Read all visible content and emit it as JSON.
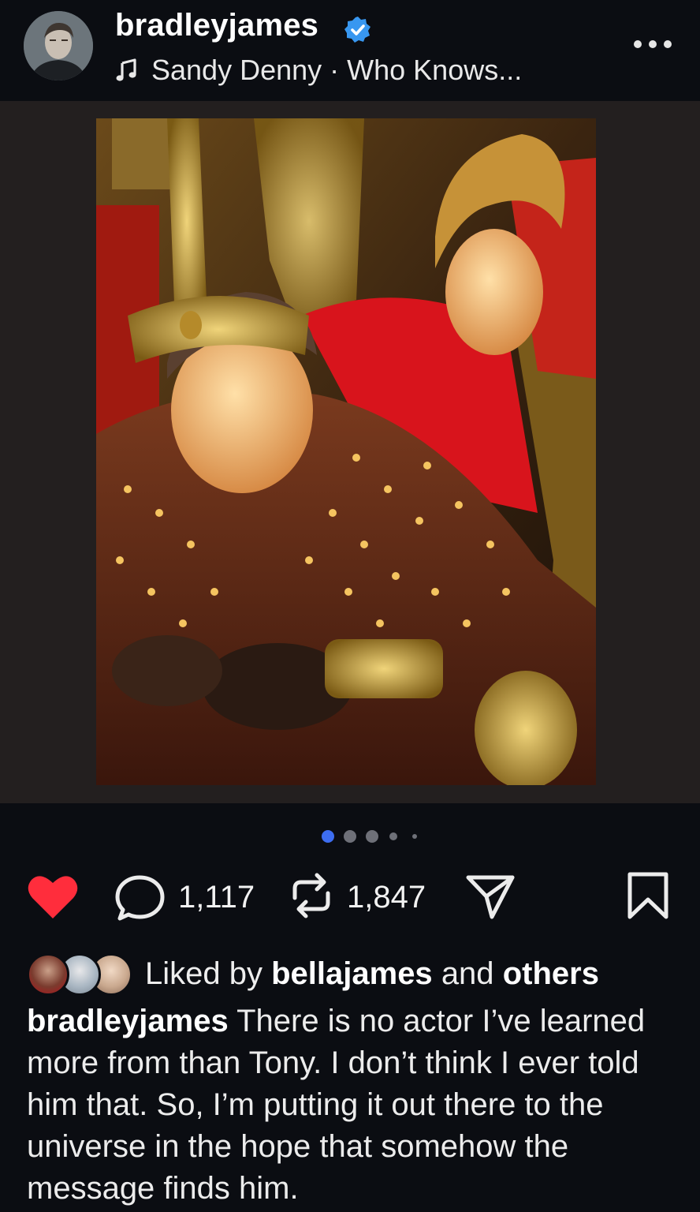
{
  "post": {
    "username": "bradleyjames",
    "music_artist": "Sandy Denny",
    "music_separator": "·",
    "music_title": "Who Knows...",
    "verified_icon": "verified-badge-icon",
    "more_icon": "more-options-icon"
  },
  "carousel": {
    "total": 5,
    "active_index": 0,
    "active_color": "#3d6df0"
  },
  "actions": {
    "liked": true,
    "like_color": "#ff2d3c",
    "comments": "1,117",
    "reposts": "1,847",
    "icons": [
      "heart-icon",
      "comment-icon",
      "repost-icon",
      "share-icon",
      "bookmark-icon"
    ]
  },
  "likes": {
    "prefix": "Liked by",
    "user": "bellajames",
    "conjunction": "and",
    "others": "others"
  },
  "caption": {
    "username": "bradleyjames",
    "text": "There is no actor I’ve learned more from than Tony. I don’t think I ever told him that. So, I’m putting it out there to the universe in the hope that somehow the message finds him."
  }
}
